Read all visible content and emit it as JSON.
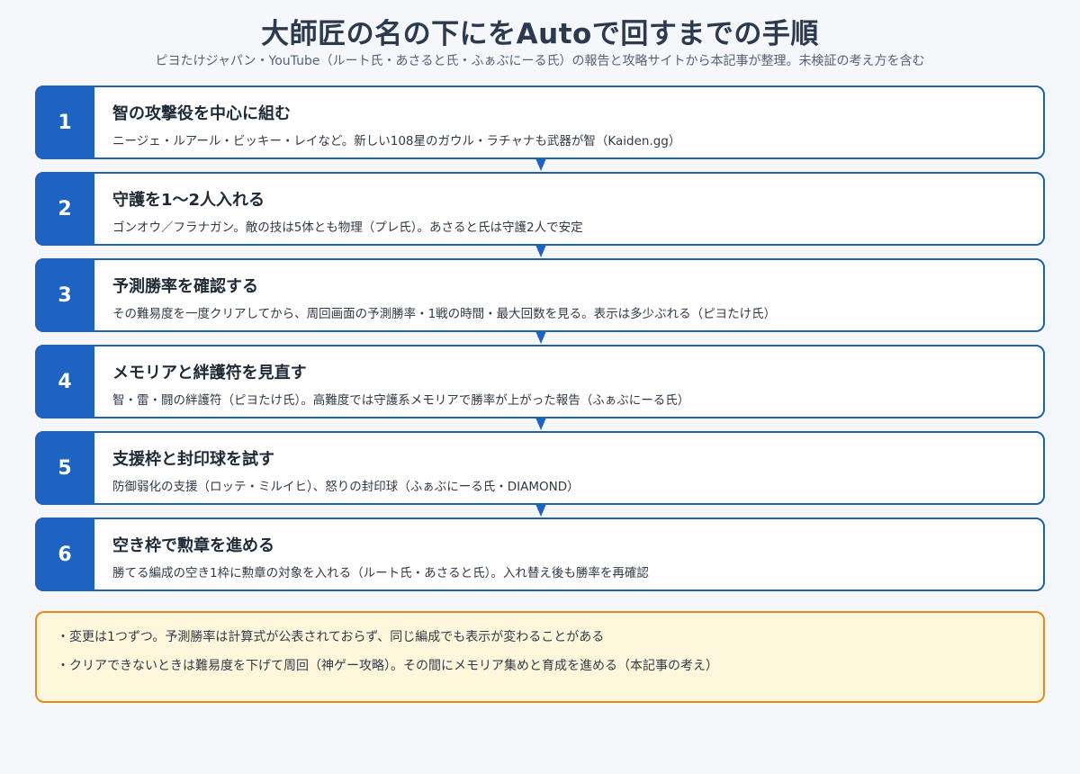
{
  "header": {
    "title": "大師匠の名の下にをAutoで回すまでの手順",
    "subtitle": "ピヨたけジャパン・YouTube（ルート氏・あさると氏・ふぁぶにーる氏）の報告と攻略サイトから本記事が整理。未検証の考え方を含む"
  },
  "steps": [
    {
      "number": "1",
      "title": "智の攻撃役を中心に組む",
      "description": "ニージェ・ルアール・ビッキー・レイなど。新しい108星のガウル・ラチャナも武器が智（Kaiden.gg）"
    },
    {
      "number": "2",
      "title": "守護を1〜2人入れる",
      "description": "ゴンオウ／フラナガン。敵の技は5体とも物理（プレ氏）。あさると氏は守護2人で安定"
    },
    {
      "number": "3",
      "title": "予測勝率を確認する",
      "description": "その難易度を一度クリアしてから、周回画面の予測勝率・1戦の時間・最大回数を見る。表示は多少ぶれる（ピヨたけ氏）"
    },
    {
      "number": "4",
      "title": "メモリアと絆護符を見直す",
      "description": "智・雷・闘の絆護符（ピヨたけ氏）。高難度では守護系メモリアで勝率が上がった報告（ふぁぶにーる氏）"
    },
    {
      "number": "5",
      "title": "支援枠と封印球を試す",
      "description": "防御弱化の支援（ロッテ・ミルイヒ）、怒りの封印球（ふぁぶにーる氏・DIAMOND）"
    },
    {
      "number": "6",
      "title": "空き枠で勲章を進める",
      "description": "勝てる編成の空き1枠に勲章の対象を入れる（ルート氏・あさると氏）。入れ替え後も勝率を再確認"
    }
  ],
  "notes": [
    "・変更は1つずつ。予測勝率は計算式が公表されておらず、同じ編成でも表示が変わることがある",
    "・クリアできないときは難易度を下げて周回（神ゲー攻略）。その間にメモリア集めと育成を進める（本記事の考え）"
  ]
}
